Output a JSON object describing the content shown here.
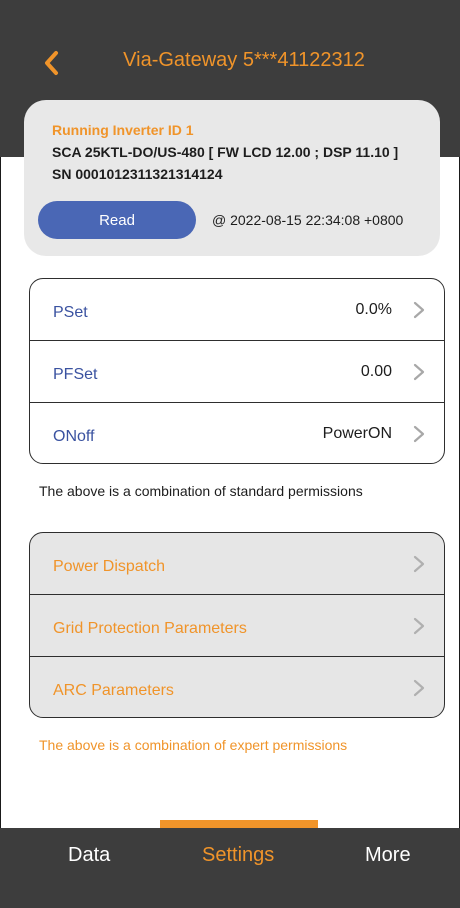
{
  "header": {
    "title": "Via-Gateway 5***41122312",
    "back_icon": "chevron-left-icon",
    "accent_color": "#f0942a",
    "bg_color": "#3d3d3d"
  },
  "inverter": {
    "id_label": "Running Inverter ID 1",
    "model_line": "SCA 25KTL-DO/US-480  [ FW LCD 12.00 ; DSP 11.10 ]",
    "sn_line": "SN 0001012311321314124",
    "read_button": "Read",
    "read_time": "@ 2022-08-15 22:34:08 +0800",
    "read_button_color": "#4a67b5"
  },
  "standard": {
    "items": [
      {
        "label": "PSet",
        "value": "0.0%"
      },
      {
        "label": "PFSet",
        "value": "0.00"
      },
      {
        "label": "ONoff",
        "value": "PowerON"
      }
    ],
    "note": "The above is a combination of standard permissions"
  },
  "expert": {
    "items": [
      {
        "label": "Power Dispatch"
      },
      {
        "label": "Grid Protection Parameters"
      },
      {
        "label": "ARC Parameters"
      }
    ],
    "note": "The above is a combination of expert permissions"
  },
  "tabs": [
    {
      "label": "Data"
    },
    {
      "label": "Settings",
      "active": true
    },
    {
      "label": "More"
    }
  ]
}
